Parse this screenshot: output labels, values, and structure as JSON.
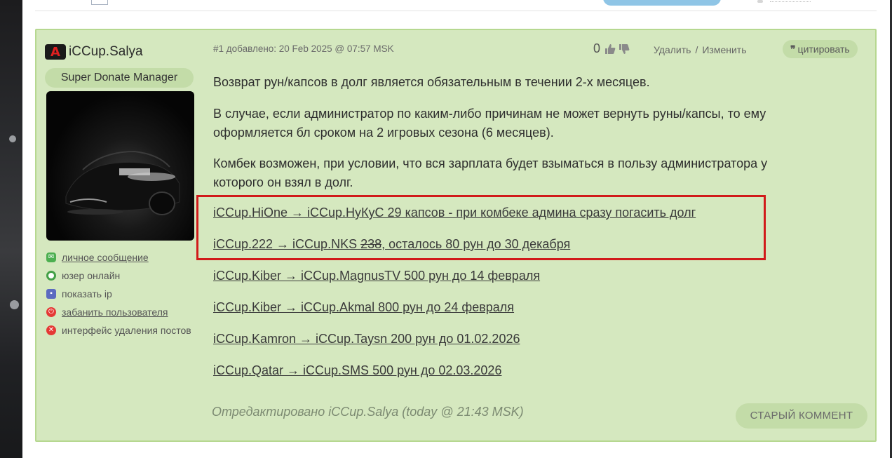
{
  "post": {
    "author": {
      "logo_text": "A",
      "name": "iCCup.Salya",
      "role": "Super Donate Manager"
    },
    "user_actions": [
      {
        "label": "личное сообщение",
        "icon": "message-icon",
        "color": "#4caf50"
      },
      {
        "label": "юзер онлайн",
        "icon": "online-icon",
        "color": "#43a047"
      },
      {
        "label": "показать ip",
        "icon": "monitor-icon",
        "color": "#5c6bc0"
      },
      {
        "label": "забанить пользователя",
        "icon": "power-icon",
        "color": "#e53935"
      },
      {
        "label": "интерфейс удаления постов",
        "icon": "delete-icon",
        "color": "#e53935"
      }
    ],
    "meta": "#1 добавлено: 20 Feb 2025 @ 07:57 MSK",
    "rating": "0",
    "actions": {
      "delete": "Удалить",
      "separator": "/",
      "edit": "Изменить"
    },
    "quote": {
      "icon": "quote-icon",
      "label": "цитировать"
    },
    "paragraphs": [
      "Возврат рун/капсов в долг является обязательным в течении 2-х месяцев.",
      "В случае, если администратор по каким-либо причинам не может вернуть руны/капсы, то ему оформляется бл сроком на 2 игровых сезона (6 месяцев).",
      "Комбек возможен, при условии, что вся зарплата будет взыматься в пользу администратора у которого он взял в долг."
    ],
    "debts": [
      {
        "text": "iCCup.HiOne → iCCup.НуКуС 29 капсов - при комбеке админа сразу погасить долг"
      },
      {
        "text_before": "iCCup.222 → iCCup.NKS ",
        "strike": "238",
        "text_after": ", осталось 80 рун до 30 декабря"
      },
      {
        "text": "iCCup.Kiber → iCCup.MagnusTV 500 рун до 14 февраля"
      },
      {
        "text": "iCCup.Kiber → iCCup.Akmal 800 рун до 24 февраля"
      },
      {
        "text": "iCCup.Kamron → iCCup.Taysn 200 рун до 01.02.2026"
      },
      {
        "text": "iCCup.Qatar → iCCup.SMS 500 рун до 02.03.2026"
      }
    ],
    "edited_note": "Отредактировано iCCup.Salya (today @ 21:43 MSK)",
    "old_comment_button": "СТАРЫЙ КОММЕНТ"
  },
  "colors": {
    "post_bg": "#d5e8bf",
    "post_border": "#b6d890",
    "highlight_box": "#d11a1a",
    "pill_bg": "#c3dca8"
  }
}
